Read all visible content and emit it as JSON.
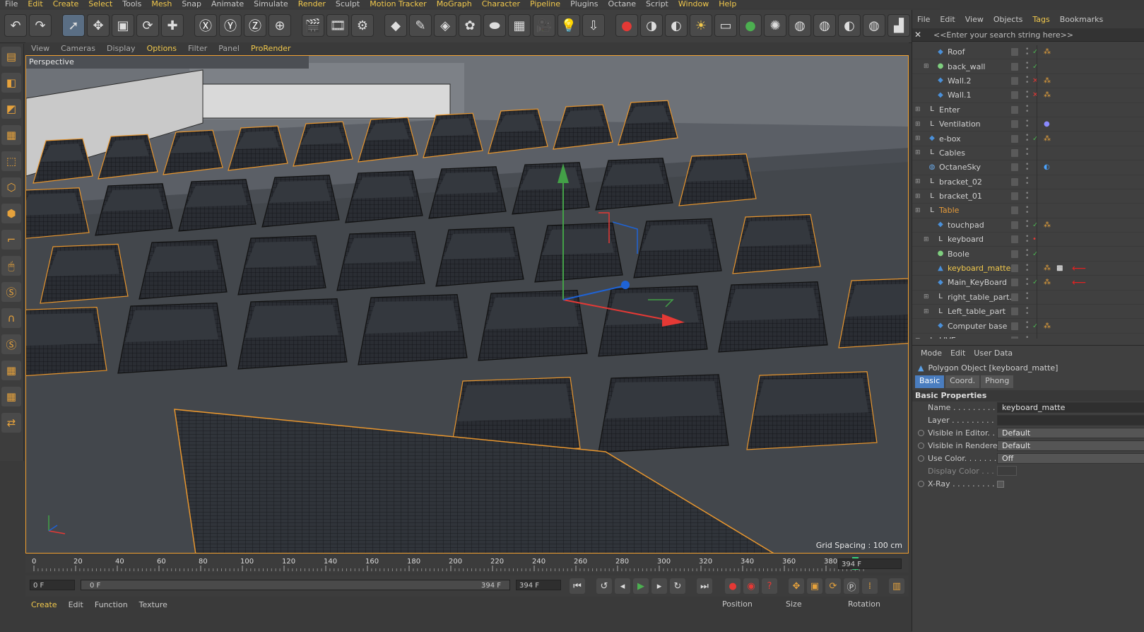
{
  "menu": [
    "File",
    "Edit",
    "Create",
    "Select",
    "Tools",
    "Mesh",
    "Snap",
    "Animate",
    "Simulate",
    "Render",
    "Sculpt",
    "Motion Tracker",
    "MoGraph",
    "Character",
    "Pipeline",
    "Plugins",
    "Octane",
    "Script",
    "Window",
    "Help"
  ],
  "menu_highlight": [
    "Edit",
    "Create",
    "Select",
    "Mesh",
    "Render",
    "Motion Tracker",
    "MoGraph",
    "Character",
    "Pipeline",
    "Window",
    "Help"
  ],
  "toolbar_icons": [
    "undo-icon",
    "redo-icon",
    "live-select-icon",
    "move-icon",
    "scale-icon",
    "rotate-icon",
    "add-object-icon",
    "x-axis-icon",
    "y-axis-icon",
    "z-axis-icon",
    "world-coord-icon",
    "render-view-icon",
    "render-picture-viewer-icon",
    "render-settings-icon",
    "cube-icon",
    "pen-icon",
    "subdivision-icon",
    "cloner-icon",
    "deformer-icon",
    "plane-icon",
    "camera-icon",
    "light-icon",
    "floor-icon",
    "octane-render-icon",
    "octane-live-icon",
    "octane-sky-icon",
    "octane-sun-icon",
    "octane-light-icon",
    "octane-mat-icon",
    "octane-settings-icon",
    "octane-sphere-icon",
    "octane-glass-icon",
    "octane-mix-icon",
    "octane-metal-icon",
    "octane-layout-icon"
  ],
  "viewport_menu": [
    "View",
    "Cameras",
    "Display",
    "Options",
    "Filter",
    "Panel",
    "ProRender"
  ],
  "viewport_menu_highlight": [
    "Options",
    "ProRender"
  ],
  "viewport": {
    "label": "Perspective",
    "grid_spacing": "Grid Spacing : 100 cm"
  },
  "timeline": {
    "ticks": [
      "0",
      "20",
      "40",
      "60",
      "80",
      "100",
      "120",
      "140",
      "160",
      "180",
      "200",
      "220",
      "240",
      "260",
      "280",
      "300",
      "320",
      "340",
      "360",
      "380"
    ],
    "end_frame_field": "394 F",
    "current_frame": "0 F",
    "range_start": "0 F",
    "range_end": "394 F",
    "max_frame": "394 F"
  },
  "bottom_tabs": [
    "Create",
    "Edit",
    "Function",
    "Texture"
  ],
  "coord_headers": [
    "Position",
    "Size",
    "Rotation"
  ],
  "om_menu": [
    "File",
    "Edit",
    "View",
    "Objects",
    "Tags",
    "Bookmarks"
  ],
  "search_placeholder": "<<Enter your search string here>>",
  "objects": [
    {
      "name": "Roof",
      "indent": 1,
      "expand": "",
      "icon": "polygon",
      "check": "✓",
      "tag": "material"
    },
    {
      "name": "back_wall",
      "indent": 1,
      "expand": "+",
      "icon": "sweep",
      "check": "✓",
      "tag": ""
    },
    {
      "name": "Wall.2",
      "indent": 1,
      "expand": "",
      "icon": "polygon",
      "check": "✕",
      "tag": "material"
    },
    {
      "name": "Wall.1",
      "indent": 1,
      "expand": "",
      "icon": "polygon",
      "check": "✕",
      "tag": "material"
    },
    {
      "name": "Enter",
      "indent": 0,
      "expand": "+",
      "icon": "null",
      "check": "",
      "tag": ""
    },
    {
      "name": "Ventilation",
      "indent": 0,
      "expand": "+",
      "icon": "null",
      "check": "",
      "tag": "sphere"
    },
    {
      "name": "e-box",
      "indent": 0,
      "expand": "+",
      "icon": "polygon",
      "check": "✓",
      "tag": "material"
    },
    {
      "name": "Cables",
      "indent": 0,
      "expand": "+",
      "icon": "null",
      "check": "",
      "tag": ""
    },
    {
      "name": "OctaneSky",
      "indent": 0,
      "expand": "",
      "icon": "sky",
      "check": "",
      "tag": "octane"
    },
    {
      "name": "bracket_02",
      "indent": 0,
      "expand": "+",
      "icon": "null",
      "check": "",
      "tag": ""
    },
    {
      "name": "bracket_01",
      "indent": 0,
      "expand": "+",
      "icon": "null",
      "check": "",
      "tag": ""
    },
    {
      "name": "Table",
      "indent": 0,
      "expand": "−",
      "icon": "null",
      "check": "",
      "tag": "",
      "style": "or"
    },
    {
      "name": "touchpad",
      "indent": 1,
      "expand": "",
      "icon": "polygon",
      "check": "✓",
      "tag": "material"
    },
    {
      "name": "keyboard",
      "indent": 1,
      "expand": "+",
      "icon": "null",
      "check": "•",
      "tag": ""
    },
    {
      "name": "Boole",
      "indent": 1,
      "expand": "",
      "icon": "boole",
      "check": "✓",
      "tag": ""
    },
    {
      "name": "keyboard_matte",
      "indent": 1,
      "expand": "",
      "icon": "mesh",
      "check": "",
      "tag": "material+checker",
      "style": "hl",
      "arrow": true
    },
    {
      "name": "Main_KeyBoard",
      "indent": 1,
      "expand": "",
      "icon": "polygon",
      "check": "✓",
      "tag": "material",
      "arrow": true
    },
    {
      "name": "right_table_part.1",
      "indent": 1,
      "expand": "+",
      "icon": "null",
      "check": "",
      "tag": ""
    },
    {
      "name": "Left_table_part",
      "indent": 1,
      "expand": "+",
      "icon": "null",
      "check": "",
      "tag": ""
    },
    {
      "name": "Computer base",
      "indent": 1,
      "expand": "",
      "icon": "polygon",
      "check": "✓",
      "tag": "material"
    },
    {
      "name": "LIVE",
      "indent": 0,
      "expand": "+",
      "icon": "null",
      "check": "",
      "tag": ""
    }
  ],
  "attr_menu": [
    "Mode",
    "Edit",
    "User Data"
  ],
  "attr_title": "Polygon Object [keyboard_matte]",
  "attr_tabs": [
    "Basic",
    "Coord.",
    "Phong"
  ],
  "attr_section": "Basic Properties",
  "props": [
    {
      "label": "Name . . . . . . . . . . .",
      "value": "keyboard_matte",
      "kind": "text",
      "radio": false
    },
    {
      "label": "Layer . . . . . . . . . . .",
      "value": "",
      "kind": "text",
      "radio": false
    },
    {
      "label": "Visible in Editor. . .",
      "value": "Default",
      "kind": "drop",
      "radio": true
    },
    {
      "label": "Visible in Renderer",
      "value": "Default",
      "kind": "drop",
      "radio": true
    },
    {
      "label": "Use Color. . . . . . . .",
      "value": "Off",
      "kind": "drop",
      "radio": true
    },
    {
      "label": "Display Color . . .",
      "value": "",
      "kind": "swatch",
      "radio": false,
      "dim": true
    },
    {
      "label": "X-Ray . . . . . . . . . . .",
      "value": "",
      "kind": "check",
      "radio": true
    }
  ],
  "colors": {
    "accent": "#f2c94c",
    "selection_orange": "#f0a030",
    "x_axis": "#e53935",
    "y_axis": "#43a047",
    "z_axis": "#1e63d6",
    "tab_active": "#4a7dbf"
  }
}
